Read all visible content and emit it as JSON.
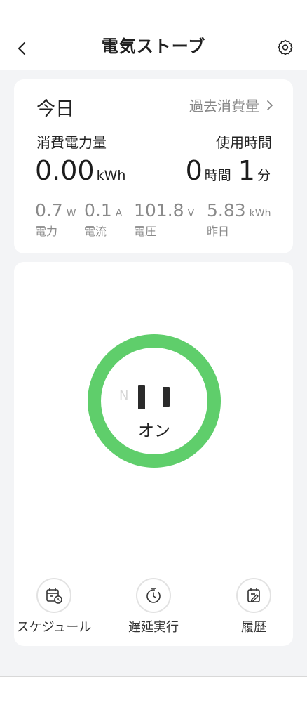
{
  "header": {
    "title": "電気ストーブ",
    "back_icon": "chevron-left-icon",
    "settings_icon": "gear-icon"
  },
  "energy": {
    "today_label": "今日",
    "history_label": "過去消費量",
    "history_chevron": "›",
    "consumption_label": "消費電力量",
    "consumption_value": "0.00",
    "consumption_unit": "kWh",
    "usetime_label": "使用時間",
    "usetime_hours": "0",
    "usetime_hours_unit": "時間",
    "usetime_minutes": "1",
    "usetime_minutes_unit": "分",
    "metrics": [
      {
        "value": "0.7",
        "unit": "W",
        "label": "電力"
      },
      {
        "value": "0.1",
        "unit": "A",
        "label": "電流"
      },
      {
        "value": "101.8",
        "unit": "V",
        "label": "電圧"
      },
      {
        "value": "5.83",
        "unit": "kWh",
        "label": "昨日"
      }
    ]
  },
  "control": {
    "socket_n_label": "N",
    "state_label": "オン",
    "ring_color": "#5fce6b",
    "actions": [
      {
        "label": "スケジュール",
        "icon": "calendar-clock-icon"
      },
      {
        "label": "遅延実行",
        "icon": "timer-icon"
      },
      {
        "label": "履歴",
        "icon": "history-log-icon"
      }
    ]
  }
}
